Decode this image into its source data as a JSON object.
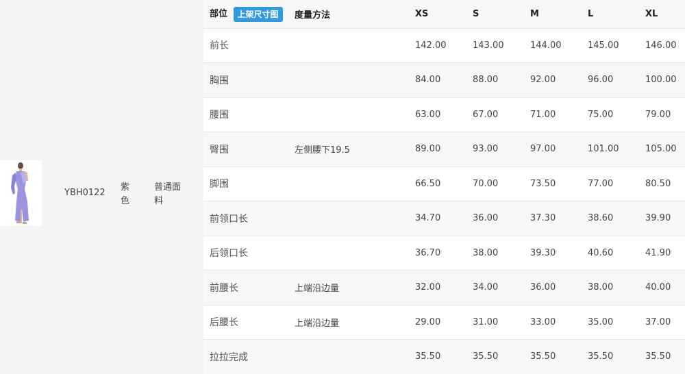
{
  "product": {
    "sku": "YBH0122",
    "color": "紫色",
    "fabric": "普通面料",
    "thumbnail_icon": "product-photo-lavender-dress"
  },
  "table": {
    "header": {
      "part": "部位",
      "chart_button": "上架尺寸图",
      "method": "度量方法",
      "sizes": [
        "XS",
        "S",
        "M",
        "L",
        "XL"
      ]
    },
    "rows": [
      {
        "part": "前长",
        "method": "",
        "values": [
          "142.00",
          "143.00",
          "144.00",
          "145.00",
          "146.00"
        ]
      },
      {
        "part": "胸围",
        "method": "",
        "values": [
          "84.00",
          "88.00",
          "92.00",
          "96.00",
          "100.00"
        ]
      },
      {
        "part": "腰围",
        "method": "",
        "values": [
          "63.00",
          "67.00",
          "71.00",
          "75.00",
          "79.00"
        ]
      },
      {
        "part": "臀围",
        "method": "左侧腰下19.5",
        "values": [
          "89.00",
          "93.00",
          "97.00",
          "101.00",
          "105.00"
        ]
      },
      {
        "part": "脚围",
        "method": "",
        "values": [
          "66.50",
          "70.00",
          "73.50",
          "77.00",
          "80.50"
        ]
      },
      {
        "part": "前领口长",
        "method": "",
        "values": [
          "34.70",
          "36.00",
          "37.30",
          "38.60",
          "39.90"
        ]
      },
      {
        "part": "后领口长",
        "method": "",
        "values": [
          "36.70",
          "38.00",
          "39.30",
          "40.60",
          "41.90"
        ]
      },
      {
        "part": "前腰长",
        "method": "上端沿边量",
        "values": [
          "32.00",
          "34.00",
          "36.00",
          "38.00",
          "40.00"
        ]
      },
      {
        "part": "后腰长",
        "method": "上端沿边量",
        "values": [
          "29.00",
          "31.00",
          "33.00",
          "35.00",
          "37.00"
        ]
      },
      {
        "part": "拉拉完成",
        "method": "",
        "values": [
          "35.50",
          "35.50",
          "35.50",
          "35.50",
          "35.50"
        ]
      }
    ]
  },
  "colors": {
    "accent": "#2f9ae0",
    "row_alt": "#f7f7f7",
    "background": "#f5f5f5"
  }
}
